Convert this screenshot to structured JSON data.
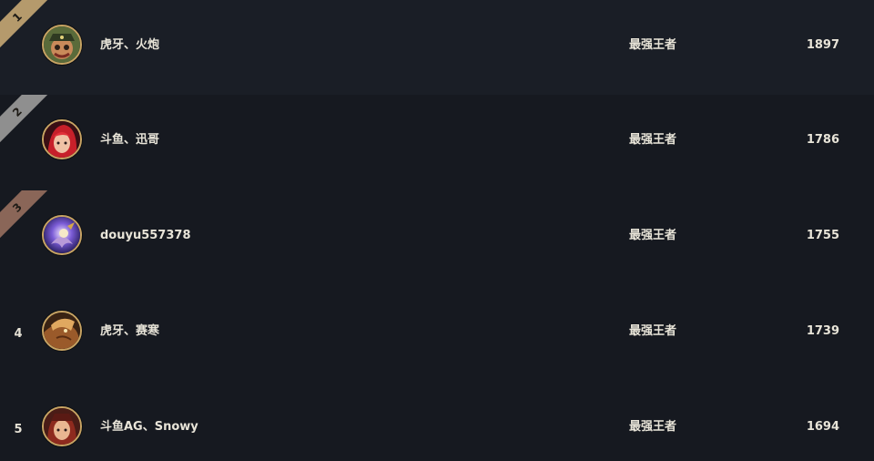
{
  "leaderboard": {
    "rows": [
      {
        "rank": "1",
        "avatar_icon": "gangplank-portrait-icon",
        "name": "虎牙、火炮",
        "tier": "最强王者",
        "points": "1897",
        "ribbon_color": "#b59a6c"
      },
      {
        "rank": "2",
        "avatar_icon": "katarina-portrait-icon",
        "name": "斗鱼、迅哥",
        "tier": "最强王者",
        "points": "1786",
        "ribbon_color": "#8f8f8f"
      },
      {
        "rank": "3",
        "avatar_icon": "purple-champion-portrait-icon",
        "name": "douyu557378",
        "tier": "最强王者",
        "points": "1755",
        "ribbon_color": "#8a6658"
      },
      {
        "rank": "4",
        "avatar_icon": "beast-champion-portrait-icon",
        "name": "虎牙、赛寒",
        "tier": "最强王者",
        "points": "1739"
      },
      {
        "rank": "5",
        "avatar_icon": "miss-fortune-portrait-icon",
        "name": "斗鱼AG、Snowy",
        "tier": "最强王者",
        "points": "1694"
      }
    ]
  }
}
